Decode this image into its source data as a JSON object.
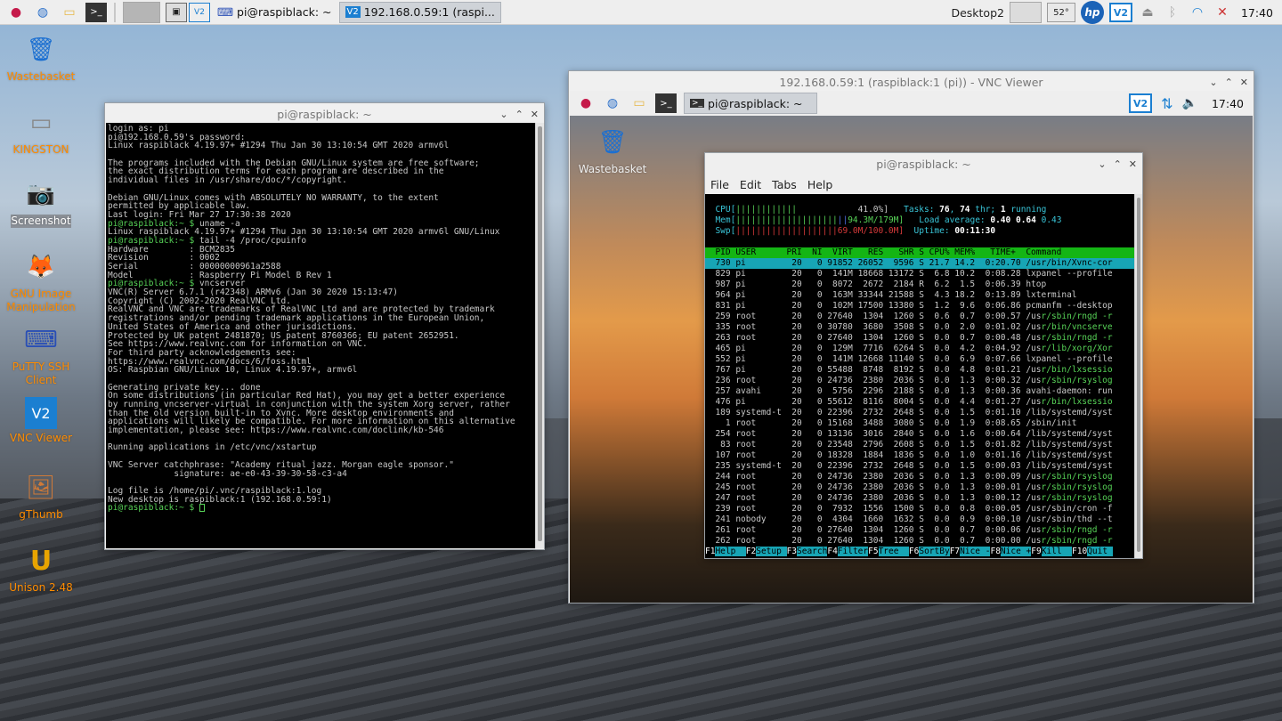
{
  "taskbar": {
    "apps": [
      "raspberry-menu",
      "web-browser",
      "file-manager",
      "terminal"
    ],
    "buttons": [
      {
        "label": "pi@raspiblack: ~",
        "active": false
      },
      {
        "label": "192.168.0.59:1 (raspi...",
        "active": true
      }
    ],
    "desktop_label": "Desktop2",
    "temp": "52°",
    "clock": "17:40"
  },
  "desktop_icons": [
    {
      "label": "Wastebasket",
      "selected": false
    },
    {
      "label": "KINGSTON",
      "selected": false
    },
    {
      "label": "Screenshot",
      "selected": true
    },
    {
      "label": "GNU Image Manipulation",
      "selected": false
    },
    {
      "label": "PuTTY SSH Client",
      "selected": false
    },
    {
      "label": "VNC Viewer",
      "selected": false
    },
    {
      "label": "gThumb",
      "selected": false
    },
    {
      "label": "Unison 2.48",
      "selected": false
    }
  ],
  "terminal": {
    "title": "pi@raspiblack: ~",
    "lines": [
      "login as: pi",
      "pi@192.168.0.59's password:",
      "Linux raspiblack 4.19.97+ #1294 Thu Jan 30 13:10:54 GMT 2020 armv6l",
      "",
      "The programs included with the Debian GNU/Linux system are free software;",
      "the exact distribution terms for each program are described in the",
      "individual files in /usr/share/doc/*/copyright.",
      "",
      "Debian GNU/Linux comes with ABSOLUTELY NO WARRANTY, to the extent",
      "permitted by applicable law.",
      "Last login: Fri Mar 27 17:30:38 2020",
      "pi@raspiblack:~ $ uname -a",
      "Linux raspiblack 4.19.97+ #1294 Thu Jan 30 13:10:54 GMT 2020 armv6l GNU/Linux",
      "pi@raspiblack:~ $ tail -4 /proc/cpuinfo",
      "Hardware        : BCM2835",
      "Revision        : 0002",
      "Serial          : 00000000961a2588",
      "Model           : Raspberry Pi Model B Rev 1",
      "pi@raspiblack:~ $ vncserver",
      "VNC(R) Server 6.7.1 (r42348) ARMv6 (Jan 30 2020 15:13:47)",
      "Copyright (C) 2002-2020 RealVNC Ltd.",
      "RealVNC and VNC are trademarks of RealVNC Ltd and are protected by trademark",
      "registrations and/or pending trademark applications in the European Union,",
      "United States of America and other jurisdictions.",
      "Protected by UK patent 2481870; US patent 8760366; EU patent 2652951.",
      "See https://www.realvnc.com for information on VNC.",
      "For third party acknowledgements see:",
      "https://www.realvnc.com/docs/6/foss.html",
      "OS: Raspbian GNU/Linux 10, Linux 4.19.97+, armv6l",
      "",
      "Generating private key... done",
      "On some distributions (in particular Red Hat), you may get a better experience",
      "by running vncserver-virtual in conjunction with the system Xorg server, rather",
      "than the old version built-in to Xvnc. More desktop environments and",
      "applications will likely be compatible. For more information on this alternative",
      "implementation, please see: https://www.realvnc.com/doclink/kb-546",
      "",
      "Running applications in /etc/vnc/xstartup",
      "",
      "VNC Server catchphrase: \"Academy ritual jazz. Morgan eagle sponsor.\"",
      "             signature: ae-e0-43-39-30-58-c3-a4",
      "",
      "Log file is /home/pi/.vnc/raspiblack:1.log",
      "New desktop is raspiblack:1 (192.168.0.59:1)",
      "pi@raspiblack:~ $ "
    ]
  },
  "vnc": {
    "title": "192.168.0.59:1 (raspiblack:1 (pi)) - VNC Viewer",
    "panel_button": "pi@raspiblack: ~",
    "clock": "17:40",
    "wastebasket": "Wastebasket",
    "lxterm": {
      "title": "pi@raspiblack: ~",
      "menu": [
        "File",
        "Edit",
        "Tabs",
        "Help"
      ]
    },
    "htop": {
      "cpu_label": "CPU[",
      "cpu_bar": "||||||||||||",
      "cpu_val": "41.0%]",
      "mem_label": "Mem[",
      "mem_bar": "||||||||||||||||||||",
      "mem_val": "94.3M/179M]",
      "swp_label": "Swp[",
      "swp_bar": "||||||||||||||||||||",
      "swp_val": "69.0M/100.0M]",
      "tasks_label": "Tasks: ",
      "tasks_val": "76",
      "tasks_sep": ", ",
      "thr_val": "74",
      "thr_label": " thr; ",
      "run_val": "1",
      "run_label": " running",
      "load_label": "Load average: ",
      "load1": "0.40",
      "load5": "0.64",
      "load15": "0.43",
      "uptime_label": "Uptime: ",
      "uptime_val": "00:11:30",
      "header": "  PID USER      PRI  NI  VIRT   RES   SHR S CPU% MEM%   TIME+  Command",
      "rows": [
        "  730 pi         20   0 91852 26052  9596 S 21.7 14.2  0:20.70 /usr/bin/Xvnc-cor",
        "  829 pi         20   0  141M 18668 13172 S  6.8 10.2  0:08.28 lxpanel --profile",
        "  987 pi         20   0  8072  2672  2184 R  6.2  1.5  0:06.39 htop",
        "  964 pi         20   0  163M 33344 21588 S  4.3 18.2  0:13.89 lxterminal",
        "  831 pi         20   0  102M 17500 13380 S  1.2  9.6  0:06.86 pcmanfm --desktop",
        "  259 root       20   0 27640  1304  1260 S  0.6  0.7  0:00.57 /usr/sbin/rngd -r",
        "  335 root       20   0 30780  3680  3508 S  0.0  2.0  0:01.02 /usr/bin/vncserve",
        "  263 root       20   0 27640  1304  1260 S  0.0  0.7  0:00.48 /usr/sbin/rngd -r",
        "  465 pi         20   0  129M  7716  6264 S  0.0  4.2  0:04.92 /usr/lib/xorg/Xor",
        "  552 pi         20   0  141M 12668 11140 S  0.0  6.9  0:07.66 lxpanel --profile",
        "  767 pi         20   0 55488  8748  8192 S  0.0  4.8  0:01.21 /usr/bin/lxsessio",
        "  236 root       20   0 24736  2380  2036 S  0.0  1.3  0:00.32 /usr/sbin/rsyslog",
        "  257 avahi      20   0  5756  2296  2188 S  0.0  1.3  0:00.36 avahi-daemon: run",
        "  476 pi         20   0 55612  8116  8004 S  0.0  4.4  0:01.27 /usr/bin/lxsessio",
        "  189 systemd-t  20   0 22396  2732  2648 S  0.0  1.5  0:01.10 /lib/systemd/syst",
        "    1 root       20   0 15168  3488  3080 S  0.0  1.9  0:08.65 /sbin/init",
        "  254 root       20   0 13136  3016  2840 S  0.0  1.6  0:00.64 /lib/systemd/syst",
        "   83 root       20   0 23548  2796  2608 S  0.0  1.5  0:01.82 /lib/systemd/syst",
        "  107 root       20   0 18328  1884  1836 S  0.0  1.0  0:01.16 /lib/systemd/syst",
        "  235 systemd-t  20   0 22396  2732  2648 S  0.0  1.5  0:00.03 /lib/systemd/syst",
        "  244 root       20   0 24736  2380  2036 S  0.0  1.3  0:00.09 /usr/sbin/rsyslog",
        "  245 root       20   0 24736  2380  2036 S  0.0  1.3  0:00.01 /usr/sbin/rsyslog",
        "  247 root       20   0 24736  2380  2036 S  0.0  1.3  0:00.12 /usr/sbin/rsyslog",
        "  239 root       20   0  7932  1556  1500 S  0.0  0.8  0:00.05 /usr/sbin/cron -f",
        "  241 nobody     20   0  4304  1660  1632 S  0.0  0.9  0:00.10 /usr/sbin/thd --t",
        "  261 root       20   0 27640  1304  1260 S  0.0  0.7  0:00.06 /usr/sbin/rngd -r",
        "  262 root       20   0 27640  1304  1260 S  0.0  0.7  0:00.00 /usr/sbin/rngd -r"
      ],
      "fkeys": [
        {
          "num": "F1",
          "label": "Help  "
        },
        {
          "num": "F2",
          "label": "Setup "
        },
        {
          "num": "F3",
          "label": "Search"
        },
        {
          "num": "F4",
          "label": "Filter"
        },
        {
          "num": "F5",
          "label": "Tree  "
        },
        {
          "num": "F6",
          "label": "SortBy"
        },
        {
          "num": "F7",
          "label": "Nice -"
        },
        {
          "num": "F8",
          "label": "Nice +"
        },
        {
          "num": "F9",
          "label": "Kill  "
        },
        {
          "num": "F10",
          "label": "Quit "
        }
      ]
    }
  },
  "colors": {
    "accent": "#17a5b5",
    "header_green": "#14b514",
    "label_orange": "#ff8c00"
  }
}
